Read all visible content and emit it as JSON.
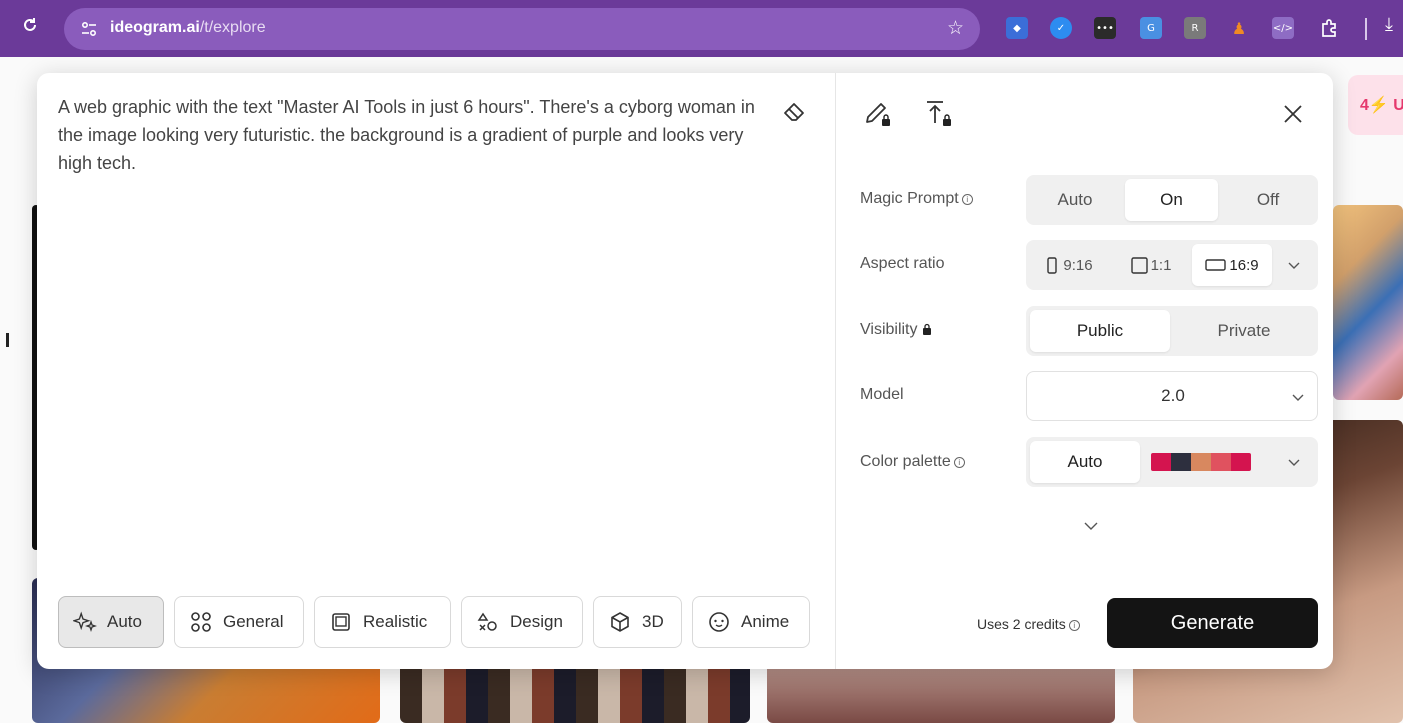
{
  "browser": {
    "url_host": "ideogram.ai",
    "url_path": "/t/explore"
  },
  "background": {
    "upgrade_label": "4⚡ U"
  },
  "prompt": {
    "text": "A web graphic with the text \"Master AI Tools in just 6 hours\". There's a cyborg woman in the image looking very futuristic. the background is a gradient of purple and looks very high tech."
  },
  "styles": [
    {
      "label": "Auto",
      "active": true
    },
    {
      "label": "General",
      "active": false
    },
    {
      "label": "Realistic",
      "active": false
    },
    {
      "label": "Design",
      "active": false
    },
    {
      "label": "3D",
      "active": false
    },
    {
      "label": "Anime",
      "active": false
    }
  ],
  "settings": {
    "magic_prompt": {
      "label": "Magic Prompt",
      "options": [
        "Auto",
        "On",
        "Off"
      ],
      "selected": "On"
    },
    "aspect_ratio": {
      "label": "Aspect ratio",
      "options": [
        "9:16",
        "1:1",
        "16:9"
      ],
      "selected": "16:9"
    },
    "visibility": {
      "label": "Visibility",
      "options": [
        "Public",
        "Private"
      ],
      "selected": "Public"
    },
    "model": {
      "label": "Model",
      "value": "2.0"
    },
    "color_palette": {
      "label": "Color palette",
      "value": "Auto",
      "swatches": [
        "#d4144f",
        "#2d2f3e",
        "#d8885f",
        "#e0525f",
        "#d4144f"
      ]
    }
  },
  "footer": {
    "credits_label": "Uses 2 credits",
    "generate_label": "Generate"
  },
  "colors": {
    "browser_bar": "#6b3a99",
    "generate_bg": "#141414",
    "accent_pink": "#e5386d"
  }
}
